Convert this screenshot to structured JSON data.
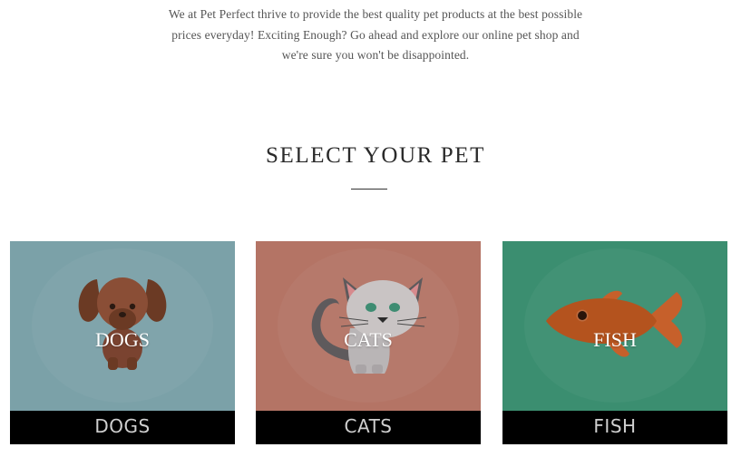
{
  "intro": {
    "line1": "We at Pet Perfect thrive to provide the best quality pet products at the best possible",
    "line2": "prices everyday! Exciting Enough? Go ahead and explore our online pet shop and",
    "line3": "we're sure you won't be disappointed."
  },
  "section": {
    "title": "SELECT YOUR PET"
  },
  "cards": [
    {
      "label": "DOGS",
      "bar_label": "DOGS",
      "bg": "#7BA1A8",
      "icon": "dog-icon"
    },
    {
      "label": "CATS",
      "bar_label": "CATS",
      "bg": "#B47465",
      "icon": "cat-icon"
    },
    {
      "label": "FISH",
      "bar_label": "FISH",
      "bg": "#3B8E70",
      "icon": "fish-icon"
    }
  ]
}
